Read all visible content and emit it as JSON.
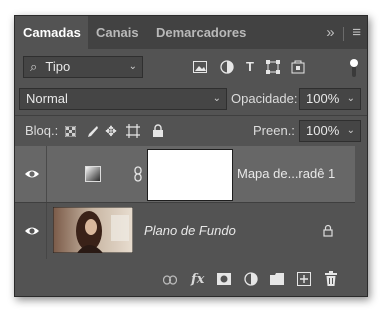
{
  "tabs": [
    {
      "label": "Camadas"
    },
    {
      "label": "Canais"
    },
    {
      "label": "Demarcadores"
    }
  ],
  "tab_menu": {
    "collapse": "»",
    "menu": "≡"
  },
  "filter": {
    "value": "Tipo",
    "icons": [
      "image-filter-icon",
      "adjustment-filter-icon",
      "type-filter-icon",
      "shape-filter-icon",
      "smart-object-filter-icon"
    ]
  },
  "blend": {
    "value": "Normal"
  },
  "opacity": {
    "label": "Opacidade:",
    "value": "100%"
  },
  "lock": {
    "label": "Bloq.:"
  },
  "fill": {
    "label": "Preen.:",
    "value": "100%"
  },
  "layers": [
    {
      "name": "Mapa de...radê 1",
      "selected": true,
      "visible": true
    },
    {
      "name": "Plano de Fundo",
      "selected": false,
      "visible": true,
      "locked": true
    }
  ],
  "colors": {
    "panel": "#535353",
    "selected_layer": "#676767",
    "tabbar": "#424242"
  }
}
